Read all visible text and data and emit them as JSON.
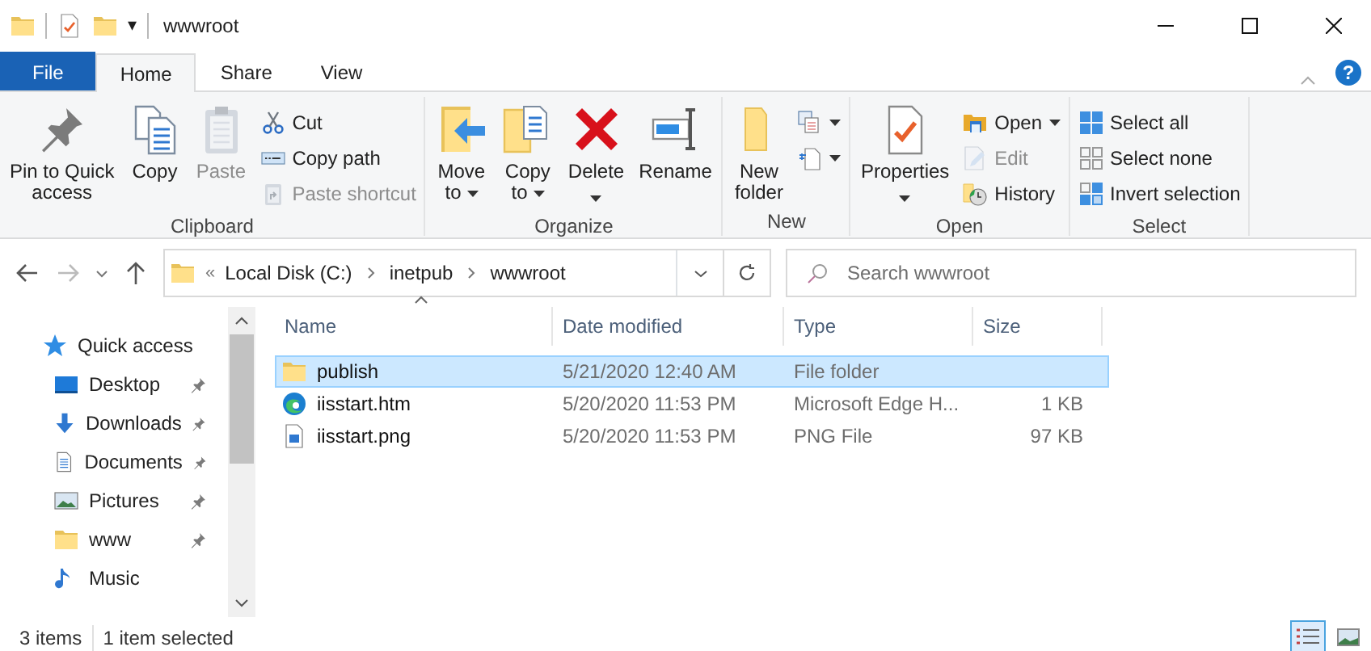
{
  "window": {
    "title": "wwwroot",
    "quick_toolbar_caret": "▾"
  },
  "ribbon_tabs": [
    {
      "label": "File",
      "kind": "file",
      "selected": false
    },
    {
      "label": "Home",
      "kind": "tab",
      "selected": true
    },
    {
      "label": "Share",
      "kind": "tab",
      "selected": false
    },
    {
      "label": "View",
      "kind": "tab",
      "selected": false
    }
  ],
  "help": "?",
  "ribbon_groups": [
    {
      "label": "Clipboard",
      "commands": [
        {
          "label": "Pin to Quick\naccess",
          "kind": "large",
          "disabled": false
        },
        {
          "label": "Copy",
          "kind": "large",
          "disabled": false
        },
        {
          "label": "Paste",
          "kind": "large",
          "disabled": true
        },
        {
          "label": "Cut",
          "kind": "small",
          "disabled": false
        },
        {
          "label": "Copy path",
          "kind": "small",
          "disabled": false
        },
        {
          "label": "Paste shortcut",
          "kind": "small",
          "disabled": true
        }
      ]
    },
    {
      "label": "Organize",
      "commands": [
        {
          "label": "Move\nto",
          "kind": "large",
          "disabled": false,
          "dropdown": true
        },
        {
          "label": "Copy\nto",
          "kind": "large",
          "disabled": false,
          "dropdown": true
        },
        {
          "label": "Delete",
          "kind": "large_menu",
          "disabled": false
        },
        {
          "label": "Rename",
          "kind": "large",
          "disabled": false
        }
      ]
    },
    {
      "label": "New",
      "commands": [
        {
          "label": "New\nfolder",
          "kind": "large",
          "disabled": false
        },
        {
          "kind": "icon",
          "dropdown": true
        },
        {
          "kind": "icon",
          "dropdown": true
        }
      ]
    },
    {
      "label": "Open",
      "commands": [
        {
          "label": "Properties",
          "kind": "large_menu",
          "disabled": false
        },
        {
          "label": "Open",
          "kind": "small",
          "disabled": false,
          "dropdown": true
        },
        {
          "label": "Edit",
          "kind": "small",
          "disabled": true
        },
        {
          "label": "History",
          "kind": "small",
          "disabled": false
        }
      ]
    },
    {
      "label": "Select",
      "commands": [
        {
          "label": "Select all",
          "kind": "small",
          "disabled": false
        },
        {
          "label": "Select none",
          "kind": "small",
          "disabled": false
        },
        {
          "label": "Invert selection",
          "kind": "small",
          "disabled": false
        }
      ]
    }
  ],
  "address_bar": {
    "overflow": "«",
    "crumbs": [
      "Local Disk (C:)",
      "inetpub",
      "wwwroot"
    ]
  },
  "search": {
    "placeholder": "Search wwwroot"
  },
  "sidebar": {
    "items": [
      {
        "label": "Quick access",
        "kind": "header",
        "pinned": false
      },
      {
        "label": "Desktop",
        "kind": "desktop",
        "pinned": true
      },
      {
        "label": "Downloads",
        "kind": "downloads",
        "pinned": true
      },
      {
        "label": "Documents",
        "kind": "documents",
        "pinned": true
      },
      {
        "label": "Pictures",
        "kind": "pictures",
        "pinned": true
      },
      {
        "label": "www",
        "kind": "folder",
        "pinned": true
      },
      {
        "label": "Music",
        "kind": "music",
        "pinned": false
      }
    ]
  },
  "table": {
    "columns": [
      {
        "label": "Name",
        "sorted": true
      },
      {
        "label": "Date modified",
        "sorted": false
      },
      {
        "label": "Type",
        "sorted": false
      },
      {
        "label": "Size",
        "sorted": false
      }
    ],
    "rows": [
      {
        "kind": "folder",
        "name": "publish",
        "date": "5/21/2020 12:40 AM",
        "type": "File folder",
        "selected": true
      },
      {
        "kind": "edge",
        "name": "iisstart.htm",
        "date": "5/20/2020 11:53 PM",
        "type": "Microsoft Edge H...",
        "size": "1 KB",
        "selected": false
      },
      {
        "kind": "image",
        "name": "iisstart.png",
        "date": "5/20/2020 11:53 PM",
        "type": "PNG File",
        "size": "97 KB",
        "selected": false
      }
    ]
  },
  "status_bar": {
    "items_count": "3 items",
    "selection": "1 item selected"
  },
  "view_buttons": [
    {
      "kind": "details",
      "selected": true
    },
    {
      "kind": "large_icons",
      "selected": false
    }
  ]
}
